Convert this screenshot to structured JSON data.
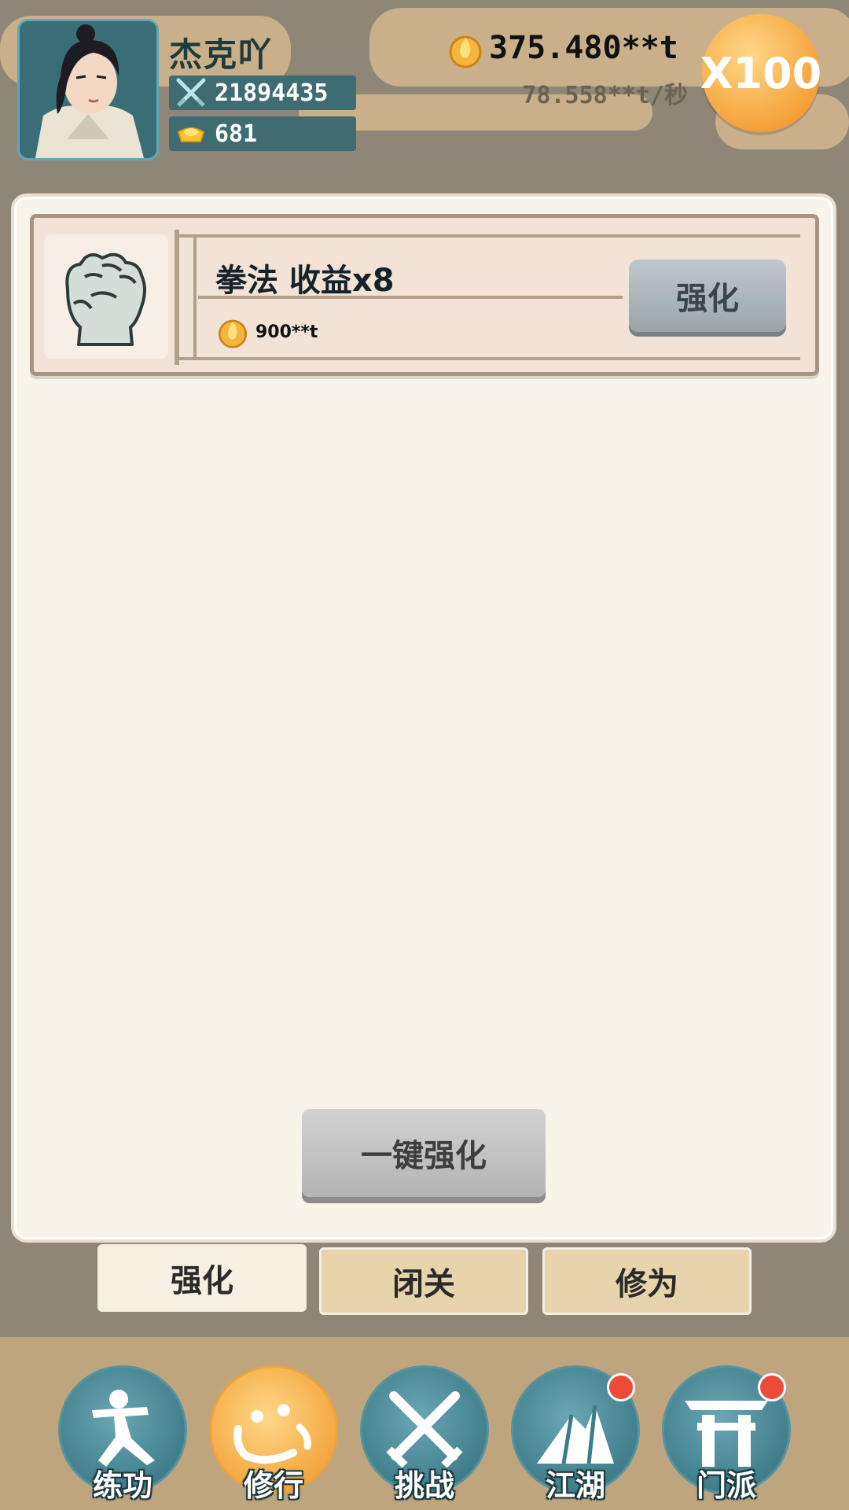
{
  "player": {
    "name": "杰克吖",
    "power": "21894435",
    "gold_ingots": "681"
  },
  "currency": {
    "amount": "375.480**t",
    "rate": "78.558**t/秒"
  },
  "multiplier": {
    "label": "X100"
  },
  "upgrade_list": {
    "items": [
      {
        "title": "拳法 收益x8",
        "cost": "900**t",
        "button_label": "强化",
        "icon": "fist-icon"
      }
    ]
  },
  "one_key_button": {
    "label": "一键强化"
  },
  "sub_tabs": [
    {
      "label": "强化",
      "active": true
    },
    {
      "label": "闭关",
      "active": false
    },
    {
      "label": "修为",
      "active": false
    }
  ],
  "bottom_nav": [
    {
      "label": "练功",
      "icon": "martial-stance-icon",
      "active": false,
      "badge": false
    },
    {
      "label": "修行",
      "icon": "heart-calligraphy-icon",
      "active": true,
      "badge": false
    },
    {
      "label": "挑战",
      "icon": "crossed-swords-icon",
      "active": false,
      "badge": false
    },
    {
      "label": "江湖",
      "icon": "mountain-icon",
      "active": false,
      "badge": true
    },
    {
      "label": "门派",
      "icon": "gate-icon",
      "active": false,
      "badge": true
    }
  ],
  "colors": {
    "background": "#8f8677",
    "panel": "#f8f4ea",
    "nav_teal": "#3e7c89",
    "nav_active_orange": "#f3a43b",
    "multiplier_orange": "#f5a23a",
    "badge_red": "#ec4b3a"
  }
}
